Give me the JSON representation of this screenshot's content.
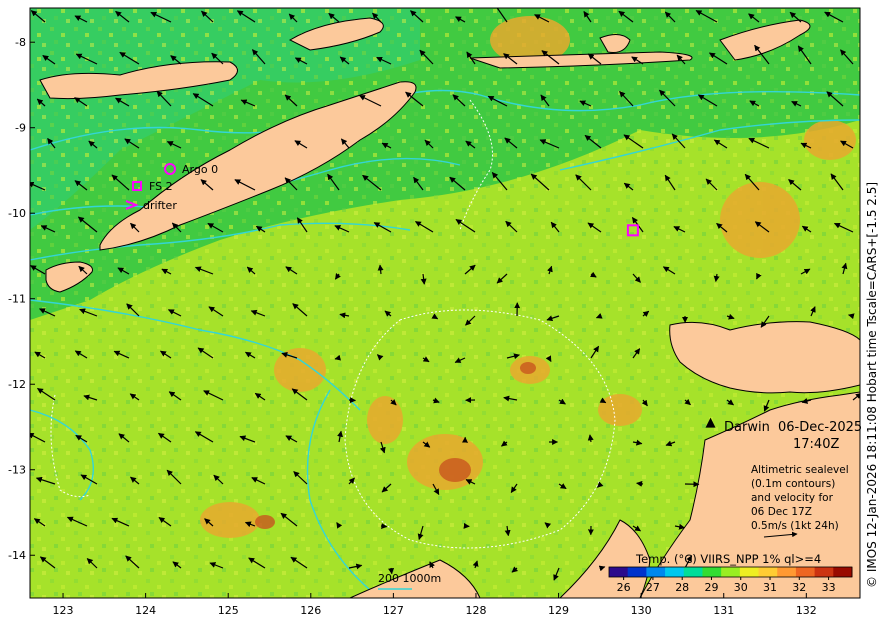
{
  "map": {
    "lon_ticks": [
      "123",
      "124",
      "125",
      "126",
      "127",
      "128",
      "129",
      "130",
      "131",
      "132"
    ],
    "lat_ticks": [
      "-8",
      "-9",
      "-10",
      "-11",
      "-12",
      "-13",
      "-14"
    ],
    "lon_range": [
      122.6,
      132.65
    ],
    "lat_range": [
      -14.5,
      -7.6
    ],
    "sea_color": "#a6e22a",
    "land_color": "#fcc99b",
    "contour_color": "#33d6d6"
  },
  "legend_markers": {
    "argo": "Argo 0",
    "fs": "FS 2",
    "drifter": "drifter"
  },
  "markers": [
    {
      "type": "fs",
      "lon": 129.9,
      "lat": -10.2
    }
  ],
  "city": {
    "name": "Darwin",
    "lon": 130.84,
    "lat": -12.46
  },
  "datetime": {
    "date": "06-Dec-2025",
    "time": "17:40Z"
  },
  "description": {
    "lines": [
      "Altimetric sealevel",
      "(0.1m contours)",
      "and velocity for",
      "06 Dec 17Z",
      "0.5m/s (1kt 24h)"
    ]
  },
  "colorbar": {
    "title": "Temp. (°C) VIIRS_NPP 1% ql>=4",
    "ticks": [
      "26",
      "27",
      "28",
      "29",
      "30",
      "31",
      "32",
      "33"
    ],
    "range": [
      25.5,
      33.8
    ],
    "colors": [
      "#2b0a8c",
      "#0033cc",
      "#0088ee",
      "#00c8ee",
      "#00dd99",
      "#33dd33",
      "#99ee22",
      "#eeee22",
      "#ffcc33",
      "#ff9933",
      "#ee6622",
      "#cc3311",
      "#990a00"
    ]
  },
  "scale_label": "200  1000m",
  "side_text": "© IMOS 12-Jan-2026 18:11:08 Hobart time Tscale=CARS+[-1.5 2.5]"
}
